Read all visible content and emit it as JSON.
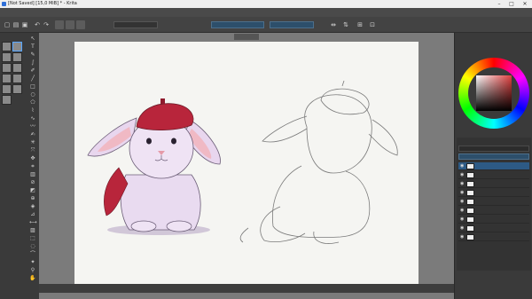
{
  "window": {
    "title": "[Not Saved] [15,0 MiB] * - Krita"
  },
  "menu": [
    {
      "label": ""
    },
    {
      "label": ""
    },
    {
      "label": ""
    },
    {
      "label": ""
    },
    {
      "label": ""
    },
    {
      "label": ""
    },
    {
      "label": ""
    },
    {
      "label": ""
    },
    {
      "label": ""
    },
    {
      "label": ""
    },
    {
      "label": ""
    }
  ],
  "toolbar": {
    "blend_mode": "",
    "opacity_label": "",
    "size_label": ""
  },
  "document": {
    "tab_label": ""
  },
  "docker": {
    "tabs": [
      "",
      ""
    ],
    "color_title": "",
    "layers_title": "",
    "blend_mode": "",
    "opacity": ""
  },
  "layers": [
    {
      "name": ""
    },
    {
      "name": ""
    },
    {
      "name": ""
    },
    {
      "name": ""
    },
    {
      "name": ""
    },
    {
      "name": ""
    },
    {
      "name": ""
    },
    {
      "name": ""
    },
    {
      "name": ""
    }
  ],
  "status": {
    "left": "",
    "center": "",
    "right": ""
  },
  "watermark": {
    "author": "",
    "logo_a": "",
    "logo_b": "",
    "logo_c": ""
  },
  "colors": {
    "accent": "#2d5a85",
    "beret": "#b8253b",
    "scarf": "#b8253b"
  }
}
